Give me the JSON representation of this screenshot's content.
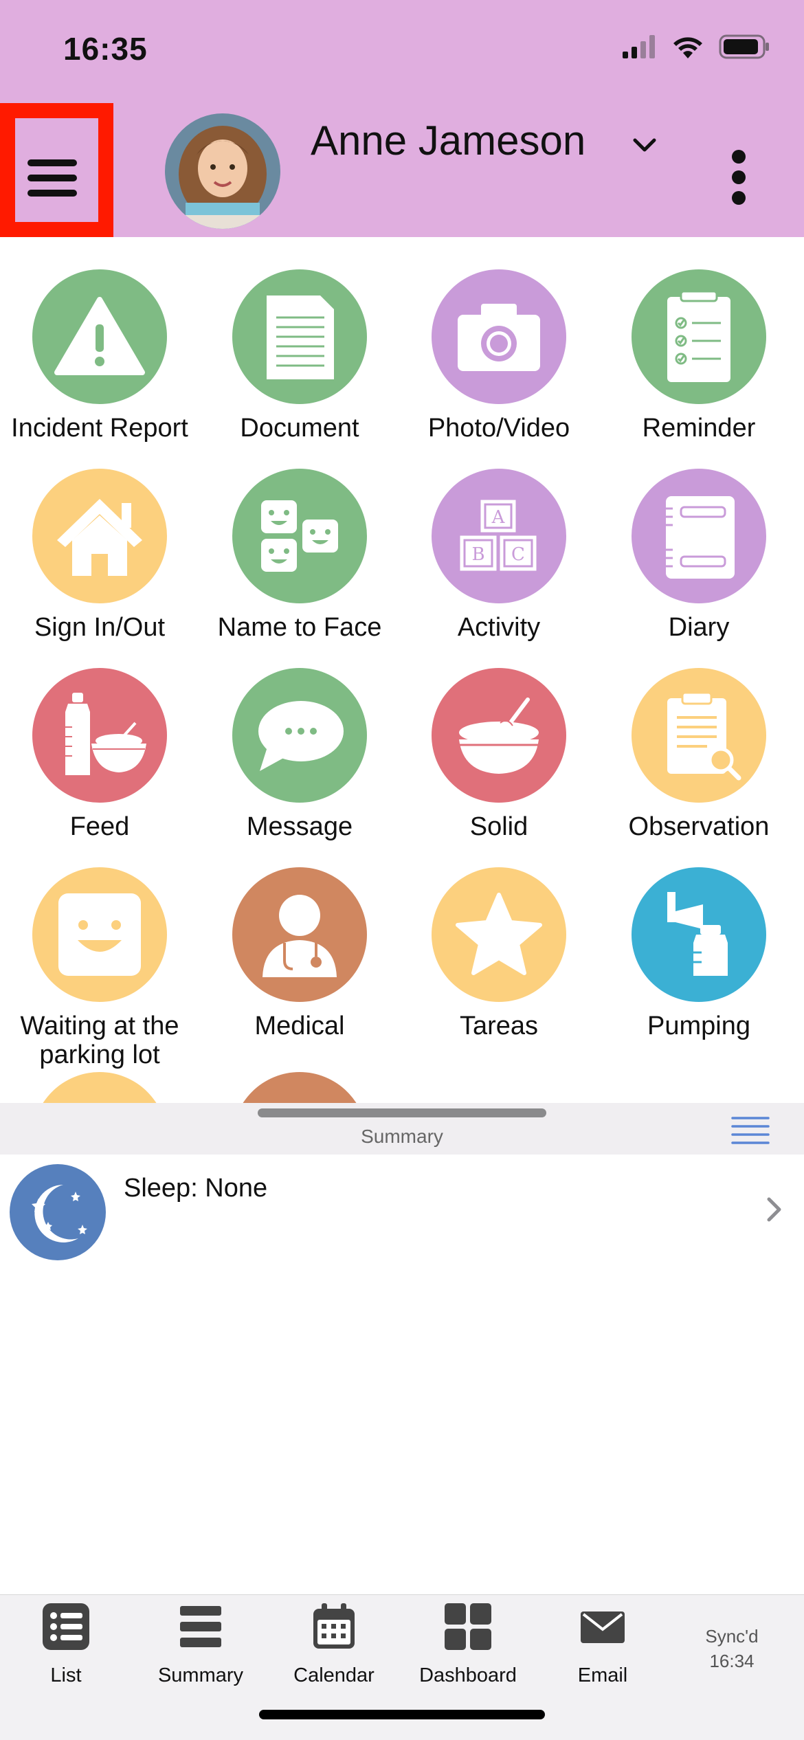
{
  "status_bar": {
    "time": "16:35"
  },
  "header": {
    "user_name": "Anne Jameson",
    "menu_icon": "hamburger-menu-icon",
    "more_icon": "kebab-menu-icon",
    "background_color": "#e0aedf"
  },
  "tiles": [
    {
      "label": "Incident Report",
      "icon": "warning-icon",
      "color": "#7fbb84"
    },
    {
      "label": "Document",
      "icon": "document-icon",
      "color": "#7fbb84"
    },
    {
      "label": "Photo/Video",
      "icon": "camera-icon",
      "color": "#c99bd9"
    },
    {
      "label": "Reminder",
      "icon": "checklist-icon",
      "color": "#7fbb84"
    },
    {
      "label": "Sign In/Out",
      "icon": "house-icon",
      "color": "#fcd07e"
    },
    {
      "label": "Name to Face",
      "icon": "faces-icon",
      "color": "#7fbb84"
    },
    {
      "label": "Activity",
      "icon": "abc-blocks-icon",
      "color": "#c99bd9"
    },
    {
      "label": "Diary",
      "icon": "diary-icon",
      "color": "#c99bd9"
    },
    {
      "label": "Feed",
      "icon": "bottle-bowl-icon",
      "color": "#e0707a"
    },
    {
      "label": "Message",
      "icon": "speech-bubble-icon",
      "color": "#7fbb84"
    },
    {
      "label": "Solid",
      "icon": "bowl-icon",
      "color": "#e0707a"
    },
    {
      "label": "Observation",
      "icon": "clipboard-magnifier-icon",
      "color": "#fcd07e"
    },
    {
      "label": "Waiting at the parking lot",
      "icon": "smiley-icon",
      "color": "#fcd07e"
    },
    {
      "label": "Medical",
      "icon": "doctor-icon",
      "color": "#d08760"
    },
    {
      "label": "Tareas",
      "icon": "star-icon",
      "color": "#fcd07e"
    },
    {
      "label": "Pumping",
      "icon": "breast-pump-icon",
      "color": "#3bb0d4"
    }
  ],
  "summary": {
    "title": "Summary",
    "rows": [
      {
        "label": "Sleep: None",
        "icon": "moon-icon",
        "color": "#5680bd"
      }
    ]
  },
  "tabbar": {
    "tabs": [
      {
        "label": "List",
        "icon": "list-icon"
      },
      {
        "label": "Summary",
        "icon": "summary-icon"
      },
      {
        "label": "Calendar",
        "icon": "calendar-icon"
      },
      {
        "label": "Dashboard",
        "icon": "dashboard-icon"
      },
      {
        "label": "Email",
        "icon": "email-icon"
      }
    ],
    "sync_label": "Sync'd",
    "sync_time": "16:34"
  }
}
